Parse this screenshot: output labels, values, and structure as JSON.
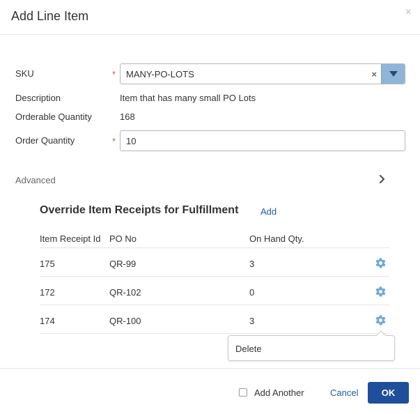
{
  "dialog": {
    "title": "Add Line Item",
    "close_glyph": "×"
  },
  "form": {
    "sku_label": "SKU",
    "sku_value": "MANY-PO-LOTS",
    "sku_clear_glyph": "×",
    "description_label": "Description",
    "description_value": "Item that has many small PO Lots",
    "orderable_label": "Orderable Quantity",
    "orderable_value": "168",
    "order_qty_label": "Order Quantity",
    "order_qty_value": "10",
    "required_marker": "*",
    "advanced_label": "Advanced"
  },
  "override": {
    "title": "Override Item Receipts for Fulfillment",
    "add_label": "Add",
    "columns": [
      "Item Receipt Id",
      "PO No",
      "On Hand Qty."
    ],
    "rows": [
      {
        "receipt_id": "175",
        "po_no": "QR-99",
        "on_hand": "3"
      },
      {
        "receipt_id": "172",
        "po_no": "QR-102",
        "on_hand": "0"
      },
      {
        "receipt_id": "174",
        "po_no": "QR-100",
        "on_hand": "3"
      }
    ],
    "menu": {
      "delete_label": "Delete"
    }
  },
  "footer": {
    "add_another_label": "Add Another",
    "add_another_checked": false,
    "cancel_label": "Cancel",
    "ok_label": "OK"
  },
  "colors": {
    "primary": "#1f4e9a",
    "link": "#1c5aa6",
    "required": "#d9534f",
    "gear": "#6fa8dc",
    "dropdown_button": "#8fb6d9"
  },
  "icons": {
    "close": "close-icon",
    "clear": "clear-icon",
    "dropdown": "caret-down-icon",
    "advanced": "chevron-right-icon",
    "row_actions": "gear-icon"
  }
}
